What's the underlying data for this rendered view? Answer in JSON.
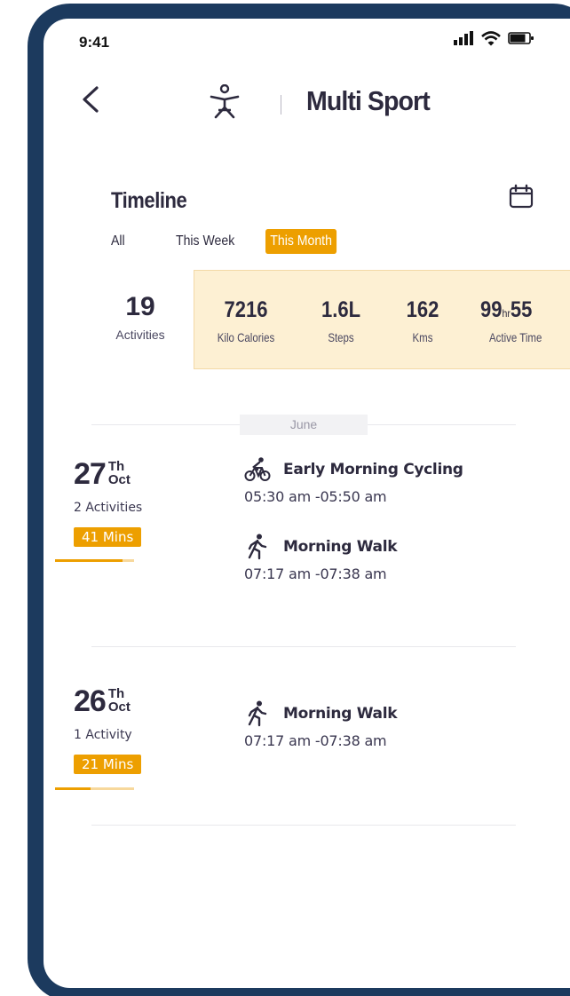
{
  "status_bar": {
    "time": "9:41"
  },
  "header": {
    "title": "Multi Sport"
  },
  "timeline": {
    "title": "Timeline",
    "filters": [
      {
        "label": "All",
        "selected": false
      },
      {
        "label": "This Week",
        "selected": false
      },
      {
        "label": "This Month",
        "selected": true
      }
    ]
  },
  "stats": {
    "activities": {
      "value": "19",
      "label": "Activities"
    },
    "items": [
      {
        "value": "7216",
        "label": "Kilo Calories"
      },
      {
        "value": "1.6L",
        "label": "Steps"
      },
      {
        "value": "162",
        "label": "Kms"
      }
    ],
    "active_time": {
      "hours": "99",
      "hr_unit": "hr",
      "minutes": "55",
      "label": "Active Time"
    }
  },
  "month_label": "June",
  "days": [
    {
      "day": "27",
      "suffix": "Th",
      "month": "Oct",
      "count": "2 Activities",
      "duration": "41 Mins",
      "progress": 0.85,
      "activities": [
        {
          "icon": "cycling-icon",
          "name": "Early Morning Cycling",
          "time": "05:30 am -05:50 am"
        },
        {
          "icon": "walking-icon",
          "name": "Morning Walk",
          "time": "07:17 am -07:38 am"
        }
      ]
    },
    {
      "day": "26",
      "suffix": "Th",
      "month": "Oct",
      "count": "1 Activity",
      "duration": "21 Mins",
      "progress": 0.45,
      "activities": [
        {
          "icon": "walking-icon",
          "name": "Morning Walk",
          "time": "07:17 am -07:38 am"
        }
      ]
    }
  ],
  "colors": {
    "accent": "#ed9f00",
    "frame": "#1c3a5e",
    "text": "#2d2a3e",
    "panel": "#fdf0d3"
  }
}
